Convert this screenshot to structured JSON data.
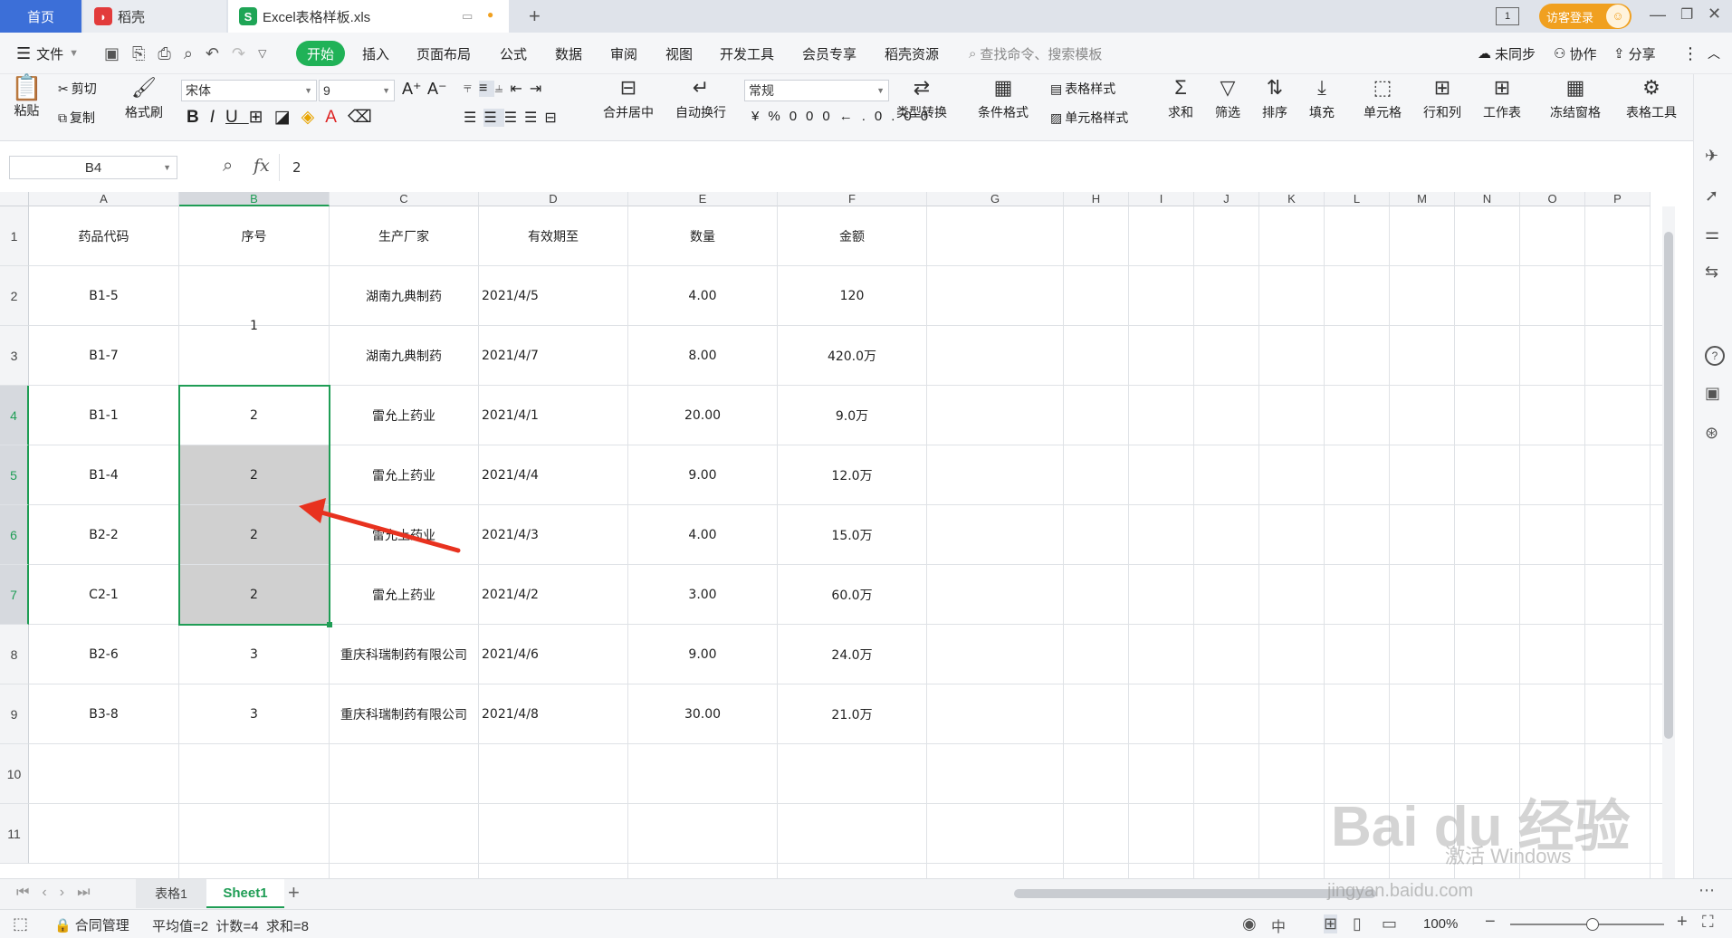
{
  "tabs": {
    "home": "首页",
    "daoke": "稻壳",
    "file": "Excel表格样板.xls",
    "login": "访客登录",
    "badge": "1"
  },
  "menu": {
    "file": "文件",
    "items": [
      "开始",
      "插入",
      "页面布局",
      "公式",
      "数据",
      "审阅",
      "视图",
      "开发工具",
      "会员专享",
      "稻壳资源"
    ],
    "search": "查找命令、搜索模板",
    "sync": "未同步",
    "collab": "协作",
    "share": "分享"
  },
  "ribbon": {
    "paste": "粘贴",
    "cut": "剪切",
    "copy": "复制",
    "format_painter": "格式刷",
    "font": "宋体",
    "font_size": "9",
    "merge": "合并居中",
    "wrap": "自动换行",
    "number_format": "常规",
    "type_convert": "类型转换",
    "cond_format": "条件格式",
    "table_style": "表格样式",
    "cell_style": "单元格样式",
    "sum": "求和",
    "filter": "筛选",
    "sort": "排序",
    "fill": "填充",
    "cell": "单元格",
    "rowcol": "行和列",
    "worksheet": "工作表",
    "freeze": "冻结窗格",
    "tools": "表格工具"
  },
  "formula": {
    "name_box": "B4",
    "fx": "fx",
    "value": "2"
  },
  "columns": [
    "A",
    "B",
    "C",
    "D",
    "E",
    "F",
    "G",
    "H",
    "I",
    "J",
    "K",
    "L",
    "M",
    "N",
    "O",
    "P"
  ],
  "rows": [
    "1",
    "2",
    "3",
    "4",
    "5",
    "6",
    "7",
    "8",
    "9",
    "10",
    "11"
  ],
  "table": {
    "header": [
      "药品代码",
      "序号",
      "生产厂家",
      "有效期至",
      "数量",
      "金额"
    ],
    "data": [
      [
        "B1-5",
        "",
        "湖南九典制药",
        "2021/4/5",
        "4.00",
        "120"
      ],
      [
        "B1-7",
        "",
        "湖南九典制药",
        "2021/4/7",
        "8.00",
        "420.0万"
      ],
      [
        "B1-1",
        "2",
        "雷允上药业",
        "2021/4/1",
        "20.00",
        "9.0万"
      ],
      [
        "B1-4",
        "2",
        "雷允上药业",
        "2021/4/4",
        "9.00",
        "12.0万"
      ],
      [
        "B2-2",
        "2",
        "雷允上药业",
        "2021/4/3",
        "4.00",
        "15.0万"
      ],
      [
        "C2-1",
        "2",
        "雷允上药业",
        "2021/4/2",
        "3.00",
        "60.0万"
      ],
      [
        "B2-6",
        "3",
        "重庆科瑞制药有限公司",
        "2021/4/6",
        "9.00",
        "24.0万"
      ],
      [
        "B3-8",
        "3",
        "重庆科瑞制药有限公司",
        "2021/4/8",
        "30.00",
        "21.0万"
      ]
    ],
    "merged_b23": "1"
  },
  "sheets": {
    "tab1": "表格1",
    "tab2": "Sheet1"
  },
  "status": {
    "contract": "合同管理",
    "summary": "平均值=2  计数=4  求和=8",
    "zoom": "100%"
  },
  "watermark": {
    "baidu": "Bai du 经验",
    "url": "jingyan.baidu.com",
    "activate": "激活 Windows"
  },
  "colors": {
    "accent_green": "#20b257",
    "home_tab": "#3c6fd8",
    "selection": "#1f9d55",
    "arrow": "#e8321f"
  }
}
